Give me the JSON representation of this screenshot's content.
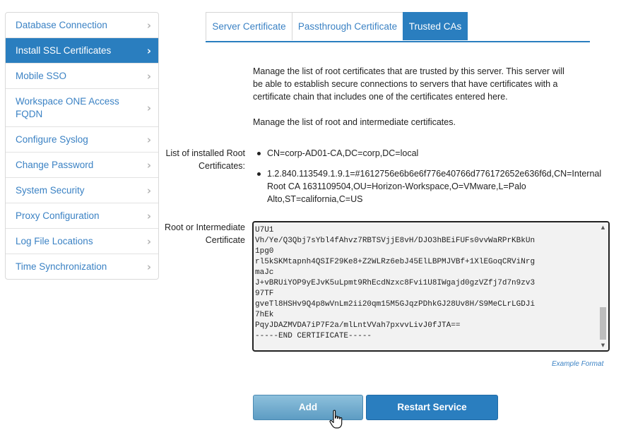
{
  "sidebar": {
    "items": [
      {
        "label": "Database Connection",
        "active": false
      },
      {
        "label": "Install SSL Certificates",
        "active": true
      },
      {
        "label": "Mobile SSO",
        "active": false
      },
      {
        "label": "Workspace ONE Access FQDN",
        "active": false
      },
      {
        "label": "Configure Syslog",
        "active": false
      },
      {
        "label": "Change Password",
        "active": false
      },
      {
        "label": "System Security",
        "active": false
      },
      {
        "label": "Proxy Configuration",
        "active": false
      },
      {
        "label": "Log File Locations",
        "active": false
      },
      {
        "label": "Time Synchronization",
        "active": false
      }
    ],
    "chevron_icon": "chevron-right-icon"
  },
  "tabs": [
    {
      "label": "Server Certificate",
      "active": false
    },
    {
      "label": "Passthrough Certificate",
      "active": false
    },
    {
      "label": "Trusted CAs",
      "active": true
    }
  ],
  "description": {
    "paragraph1": "Manage the list of root certificates that are trusted by this server. This server will be able to establish secure connections to servers that have certificates with a certificate chain that includes one of the certificates entered here.",
    "paragraph2": "Manage the list of root and intermediate certificates."
  },
  "installed": {
    "label": "List of installed Root Certificates:",
    "certificates": [
      "CN=corp-AD01-CA,DC=corp,DC=local",
      "1.2.840.113549.1.9.1=#1612756e6b6e6f776e40766d776172652e636f6d,CN=Internal Root CA 1631109504,OU=Horizon-Workspace,O=VMware,L=Palo Alto,ST=california,C=US"
    ]
  },
  "root_input": {
    "label": "Root or Intermediate Certificate",
    "value": "U7U1\nVh/Ye/Q3Qbj7sYbl4fAhvz7RBTSVjjE8vH/DJO3hBEiFUFs0vvWaRPrKBkUn\n1pg0\nrl5kSKMtapnh4QSIF29Ke8+Z2WLRz6ebJ45ElLBPMJVBf+1XlEGoqCRViNrg\nmaJc\nJ+vBRUiYOP9yEJvK5uLpmt9RhEcdNzxc8Fvi1U8IWgajd0gzVZfj7d7n9zv3\n97TF\ngveTl8HSHv9Q4p8wVnLm2ii20qm15M5GJqzPDhkGJ28Uv8H/S9MeCLrLGDJi\n7hEk\nPqyJDAZMVDA7iP7F2a/mlLntVVah7pxvvLivJ0fJTA==\n-----END CERTIFICATE-----",
    "example_link": "Example Format"
  },
  "buttons": {
    "add": "Add",
    "restart": "Restart Service"
  }
}
